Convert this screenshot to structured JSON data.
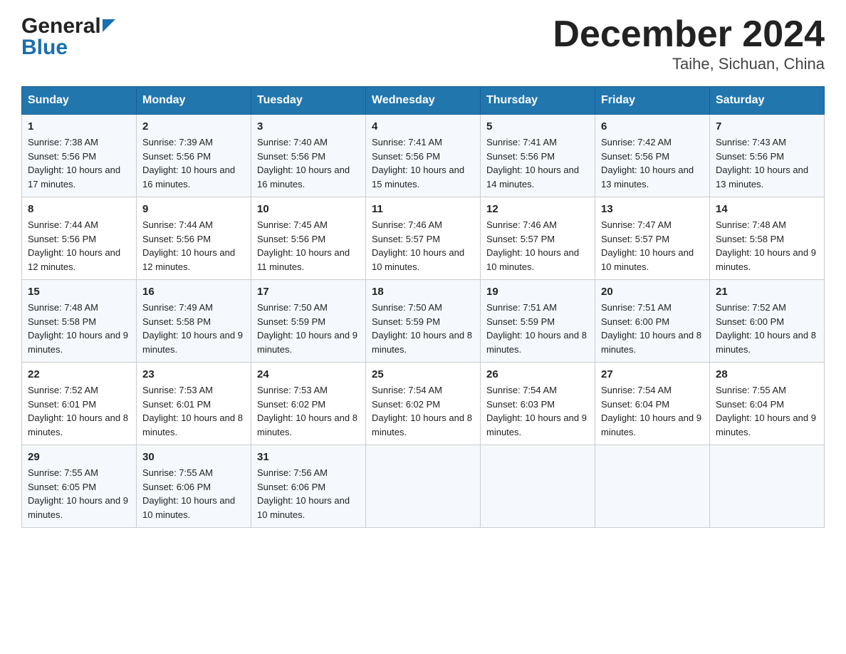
{
  "header": {
    "logo_general": "General",
    "logo_blue": "Blue",
    "title": "December 2024",
    "subtitle": "Taihe, Sichuan, China"
  },
  "days_of_week": [
    "Sunday",
    "Monday",
    "Tuesday",
    "Wednesday",
    "Thursday",
    "Friday",
    "Saturday"
  ],
  "weeks": [
    [
      {
        "num": "1",
        "sunrise": "7:38 AM",
        "sunset": "5:56 PM",
        "daylight": "10 hours and 17 minutes."
      },
      {
        "num": "2",
        "sunrise": "7:39 AM",
        "sunset": "5:56 PM",
        "daylight": "10 hours and 16 minutes."
      },
      {
        "num": "3",
        "sunrise": "7:40 AM",
        "sunset": "5:56 PM",
        "daylight": "10 hours and 16 minutes."
      },
      {
        "num": "4",
        "sunrise": "7:41 AM",
        "sunset": "5:56 PM",
        "daylight": "10 hours and 15 minutes."
      },
      {
        "num": "5",
        "sunrise": "7:41 AM",
        "sunset": "5:56 PM",
        "daylight": "10 hours and 14 minutes."
      },
      {
        "num": "6",
        "sunrise": "7:42 AM",
        "sunset": "5:56 PM",
        "daylight": "10 hours and 13 minutes."
      },
      {
        "num": "7",
        "sunrise": "7:43 AM",
        "sunset": "5:56 PM",
        "daylight": "10 hours and 13 minutes."
      }
    ],
    [
      {
        "num": "8",
        "sunrise": "7:44 AM",
        "sunset": "5:56 PM",
        "daylight": "10 hours and 12 minutes."
      },
      {
        "num": "9",
        "sunrise": "7:44 AM",
        "sunset": "5:56 PM",
        "daylight": "10 hours and 12 minutes."
      },
      {
        "num": "10",
        "sunrise": "7:45 AM",
        "sunset": "5:56 PM",
        "daylight": "10 hours and 11 minutes."
      },
      {
        "num": "11",
        "sunrise": "7:46 AM",
        "sunset": "5:57 PM",
        "daylight": "10 hours and 10 minutes."
      },
      {
        "num": "12",
        "sunrise": "7:46 AM",
        "sunset": "5:57 PM",
        "daylight": "10 hours and 10 minutes."
      },
      {
        "num": "13",
        "sunrise": "7:47 AM",
        "sunset": "5:57 PM",
        "daylight": "10 hours and 10 minutes."
      },
      {
        "num": "14",
        "sunrise": "7:48 AM",
        "sunset": "5:58 PM",
        "daylight": "10 hours and 9 minutes."
      }
    ],
    [
      {
        "num": "15",
        "sunrise": "7:48 AM",
        "sunset": "5:58 PM",
        "daylight": "10 hours and 9 minutes."
      },
      {
        "num": "16",
        "sunrise": "7:49 AM",
        "sunset": "5:58 PM",
        "daylight": "10 hours and 9 minutes."
      },
      {
        "num": "17",
        "sunrise": "7:50 AM",
        "sunset": "5:59 PM",
        "daylight": "10 hours and 9 minutes."
      },
      {
        "num": "18",
        "sunrise": "7:50 AM",
        "sunset": "5:59 PM",
        "daylight": "10 hours and 8 minutes."
      },
      {
        "num": "19",
        "sunrise": "7:51 AM",
        "sunset": "5:59 PM",
        "daylight": "10 hours and 8 minutes."
      },
      {
        "num": "20",
        "sunrise": "7:51 AM",
        "sunset": "6:00 PM",
        "daylight": "10 hours and 8 minutes."
      },
      {
        "num": "21",
        "sunrise": "7:52 AM",
        "sunset": "6:00 PM",
        "daylight": "10 hours and 8 minutes."
      }
    ],
    [
      {
        "num": "22",
        "sunrise": "7:52 AM",
        "sunset": "6:01 PM",
        "daylight": "10 hours and 8 minutes."
      },
      {
        "num": "23",
        "sunrise": "7:53 AM",
        "sunset": "6:01 PM",
        "daylight": "10 hours and 8 minutes."
      },
      {
        "num": "24",
        "sunrise": "7:53 AM",
        "sunset": "6:02 PM",
        "daylight": "10 hours and 8 minutes."
      },
      {
        "num": "25",
        "sunrise": "7:54 AM",
        "sunset": "6:02 PM",
        "daylight": "10 hours and 8 minutes."
      },
      {
        "num": "26",
        "sunrise": "7:54 AM",
        "sunset": "6:03 PM",
        "daylight": "10 hours and 9 minutes."
      },
      {
        "num": "27",
        "sunrise": "7:54 AM",
        "sunset": "6:04 PM",
        "daylight": "10 hours and 9 minutes."
      },
      {
        "num": "28",
        "sunrise": "7:55 AM",
        "sunset": "6:04 PM",
        "daylight": "10 hours and 9 minutes."
      }
    ],
    [
      {
        "num": "29",
        "sunrise": "7:55 AM",
        "sunset": "6:05 PM",
        "daylight": "10 hours and 9 minutes."
      },
      {
        "num": "30",
        "sunrise": "7:55 AM",
        "sunset": "6:06 PM",
        "daylight": "10 hours and 10 minutes."
      },
      {
        "num": "31",
        "sunrise": "7:56 AM",
        "sunset": "6:06 PM",
        "daylight": "10 hours and 10 minutes."
      },
      null,
      null,
      null,
      null
    ]
  ]
}
